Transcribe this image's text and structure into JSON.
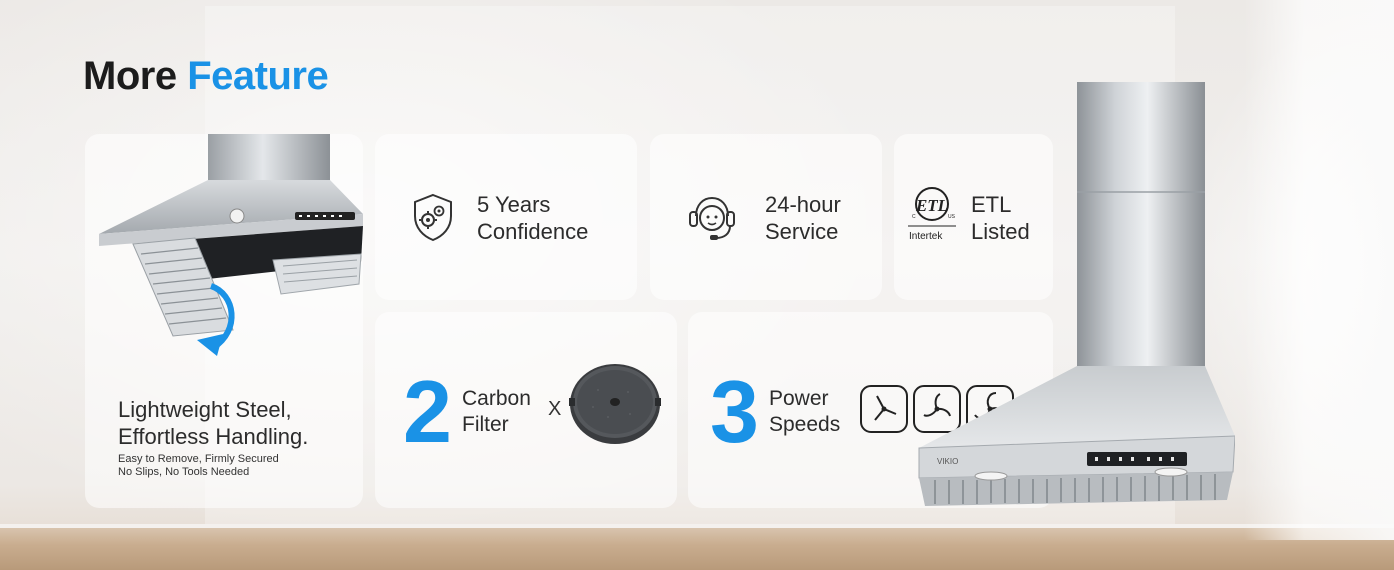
{
  "title": {
    "part1": "More",
    "part2": "Feature"
  },
  "colors": {
    "accent": "#1a92e6",
    "text": "#2c2c2c",
    "card": "rgba(255,255,255,0.55)"
  },
  "steel": {
    "headline_line1": "Lightweight Steel,",
    "headline_line2": "Effortless Handling.",
    "sub_line1": "Easy to Remove, Firmly Secured",
    "sub_line2": "No Slips, No Tools Needed",
    "icon": "range-hood-filter-image"
  },
  "warranty": {
    "line1": "5 Years",
    "line2": "Confidence",
    "icon": "shield-gear-icon"
  },
  "service": {
    "line1": "24-hour",
    "line2": "Service",
    "icon": "headset-agent-icon"
  },
  "etl": {
    "line1": "ETL",
    "line2": "Listed",
    "logo_text": "Intertek",
    "logo_mark": "ETL",
    "logo_c": "C",
    "logo_us": "US",
    "icon": "etl-intertek-logo"
  },
  "filter": {
    "count": "2",
    "line1": "Carbon",
    "line2": "Filter",
    "times": "X",
    "icon": "carbon-filter-image"
  },
  "speeds": {
    "count": "3",
    "line1": "Power",
    "line2": "Speeds",
    "icons": [
      "fan-speed-1-icon",
      "fan-speed-2-icon",
      "fan-speed-3-icon"
    ]
  },
  "product": {
    "brand": "VIKIO",
    "icon": "range-hood-product-image"
  }
}
